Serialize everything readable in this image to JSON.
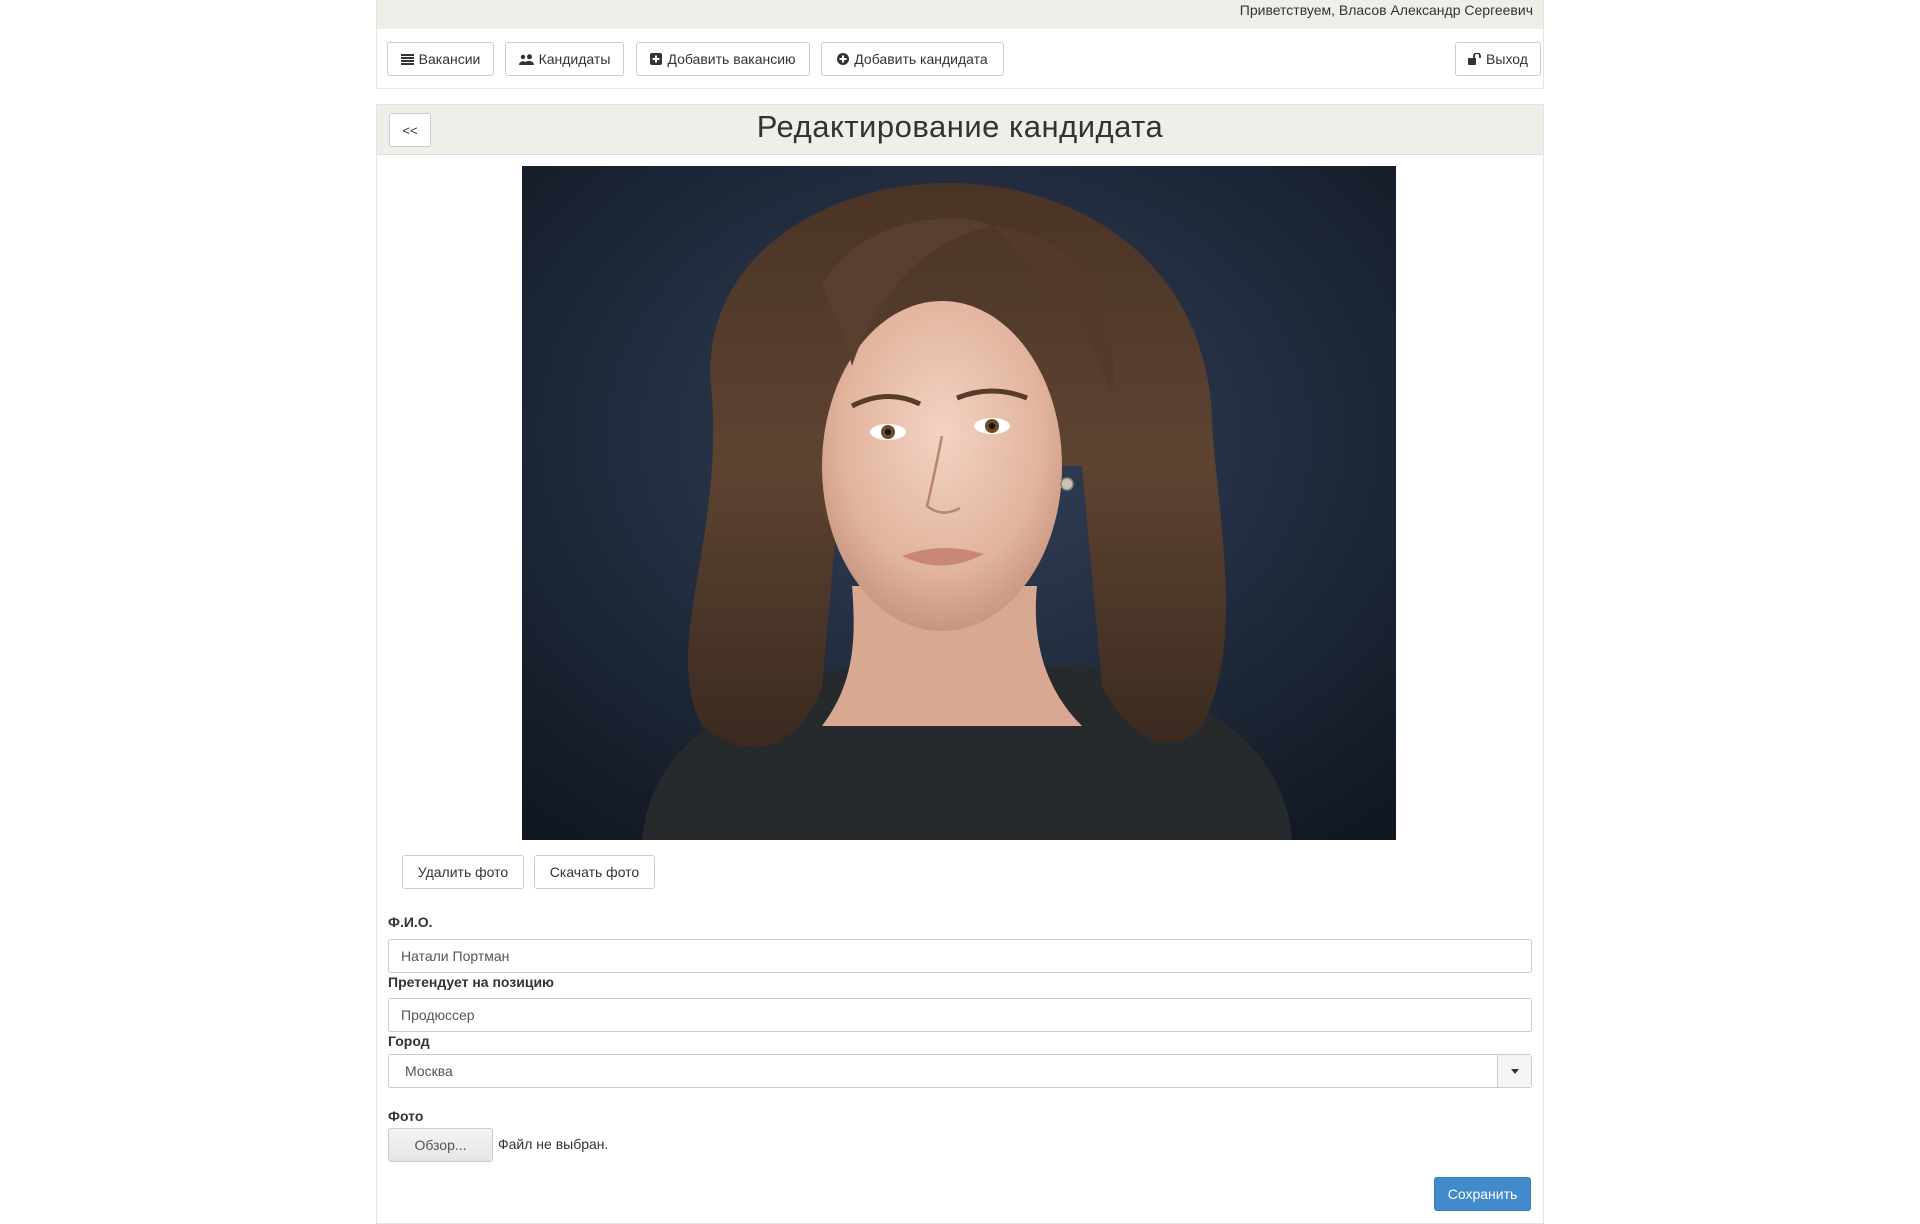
{
  "header": {
    "greeting": "Приветствуем, Власов Александр Сергеевич"
  },
  "nav": {
    "vacancies_label": "Вакансии",
    "candidates_label": "Кандидаты",
    "add_vacancy_label": "Добавить вакансию",
    "add_candidate_label": "Добавить кандидата",
    "logout_label": "Выход"
  },
  "page": {
    "back_label": "<<",
    "title": "Редактирование кандидата"
  },
  "photo_actions": {
    "delete_label": "Удалить фото",
    "download_label": "Скачать фото"
  },
  "form": {
    "fio_label": "Ф.И.О.",
    "fio_value": "Натали Портман",
    "position_label": "Претендует на позицию",
    "position_value": "Продюссер",
    "city_label": "Город",
    "city_value": "Москва",
    "photo_label": "Фото",
    "browse_label": "Обзор...",
    "file_status": "Файл не выбран.",
    "save_label": "Сохранить"
  },
  "icons": {
    "vacancies": "list-icon",
    "candidates": "users-icon",
    "add_vacancy": "plus-square-icon",
    "add_candidate": "plus-circle-icon",
    "logout": "unlock-icon",
    "city_dropdown": "caret-down-icon"
  },
  "colors": {
    "header_bg": "#efefe9",
    "primary": "#428bca",
    "photo_backdrop": "#1b2433"
  }
}
